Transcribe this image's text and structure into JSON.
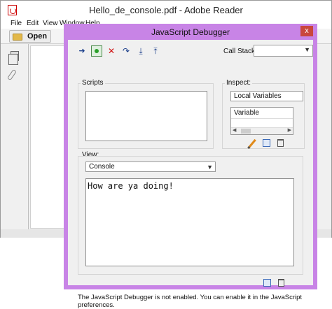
{
  "reader": {
    "title": "Hello_de_console.pdf - Adobe Reader",
    "menu": [
      "File",
      "Edit",
      "View",
      "Window",
      "Help"
    ],
    "toolbar": {
      "open_label": "Open"
    }
  },
  "debugger": {
    "title": "JavaScript Debugger",
    "close_label": "x",
    "callstack_label": "Call Stack:",
    "callstack_value": "",
    "scripts_label": "Scripts",
    "inspect_label": "Inspect:",
    "inspect_selected": "Local Variables",
    "variable_header": "Variable",
    "view_label": "View:",
    "view_selected": "Console",
    "console_text": "How are ya doing!",
    "status_text": "The JavaScript Debugger is not enabled. You can enable it in the JavaScript preferences.",
    "toolbar_icons": [
      "step-icon",
      "break-icon",
      "stop-icon",
      "step-over-icon",
      "step-into-icon",
      "step-out-icon"
    ]
  },
  "colors": {
    "dialog_frame": "#c884e6",
    "close_button": "#c9463d",
    "dialog_body": "#f0f0f0"
  }
}
